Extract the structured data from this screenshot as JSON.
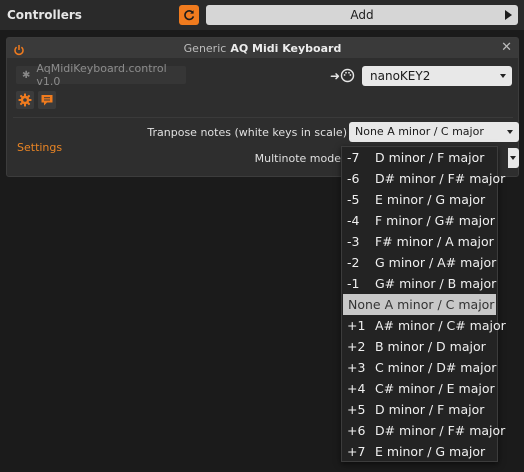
{
  "topbar": {
    "title": "Controllers",
    "add_label": "Add"
  },
  "controller": {
    "vendor": "Generic",
    "name": "AQ Midi Keyboard",
    "script": "AqMidiKeyboard.control v1.0",
    "midi_input": "nanoKEY2",
    "settings_label": "Settings",
    "transpose_label": "Tranpose notes (white keys in scale)",
    "transpose_value": "None A minor / C major",
    "multinote_label": "Multinote mode"
  },
  "dropdown": {
    "options": [
      {
        "num": "-7",
        "label": "D minor / F major"
      },
      {
        "num": "-6",
        "label": "D# minor / F# major"
      },
      {
        "num": "-5",
        "label": "E minor / G major"
      },
      {
        "num": "-4",
        "label": "F minor / G# major"
      },
      {
        "num": "-3",
        "label": "F# minor / A major"
      },
      {
        "num": "-2",
        "label": "G minor / A# major"
      },
      {
        "num": "-1",
        "label": "G# minor / B major"
      },
      {
        "num": "None",
        "label": "A minor / C major",
        "selected": true
      },
      {
        "num": "+1",
        "label": "A# minor / C# major"
      },
      {
        "num": "+2",
        "label": "B minor / D major"
      },
      {
        "num": "+3",
        "label": "C minor / D# major"
      },
      {
        "num": "+4",
        "label": "C# minor / E major"
      },
      {
        "num": "+5",
        "label": "D minor / F major"
      },
      {
        "num": "+6",
        "label": "D# minor / F# major"
      },
      {
        "num": "+7",
        "label": "E minor / G major"
      }
    ]
  },
  "colors": {
    "accent": "#f07b1e",
    "background": "#1b1b1b",
    "panel": "#2e2e2e"
  },
  "icons": {
    "refresh": "refresh-icon",
    "power": "power-icon",
    "close": "close-icon",
    "settings": "gear-icon",
    "notes": "comment-icon",
    "midi_port": "midi-port-icon"
  }
}
